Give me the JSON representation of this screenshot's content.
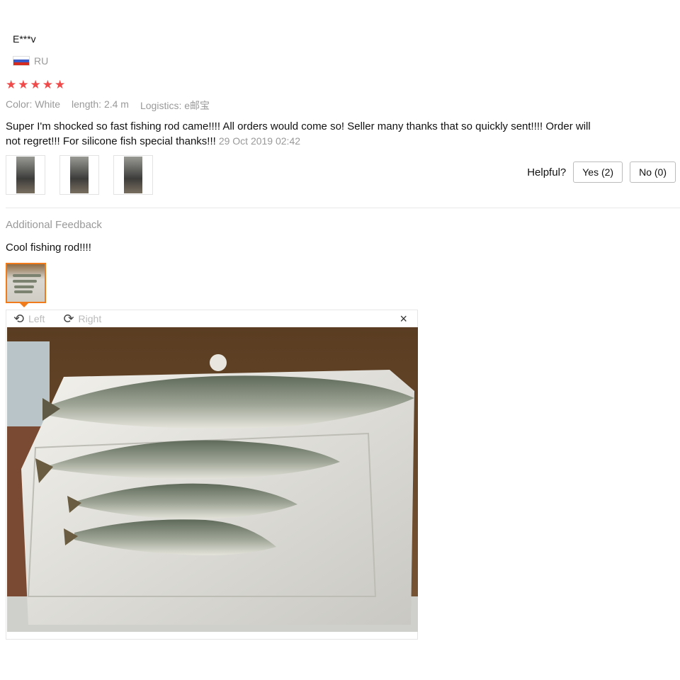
{
  "review": {
    "user": "E***v",
    "country": "RU",
    "rating": 5,
    "color": "Color: White",
    "length": "length: 2.4 m",
    "logistics": "Logistics: e邮宝",
    "text": "Super I'm shocked so fast fishing rod came!!!! All orders would come so! Seller many thanks that so quickly sent!!!! Order will not regret!!! For silicone fish special thanks!!!",
    "date": "29 Oct 2019 02:42"
  },
  "helpful": {
    "label": "Helpful?",
    "yes": "Yes (2)",
    "no": "No (0)"
  },
  "additional": {
    "title": "Additional Feedback",
    "text": "Cool fishing rod!!!!"
  },
  "viewer": {
    "rotate_left": "Left",
    "rotate_right": "Right",
    "close": "×"
  },
  "icons": {
    "star": "★",
    "rotate_left": "⟲",
    "rotate_right": "⟳"
  },
  "colors": {
    "star": "#f04a4a",
    "selected_border": "#f07b1d"
  }
}
